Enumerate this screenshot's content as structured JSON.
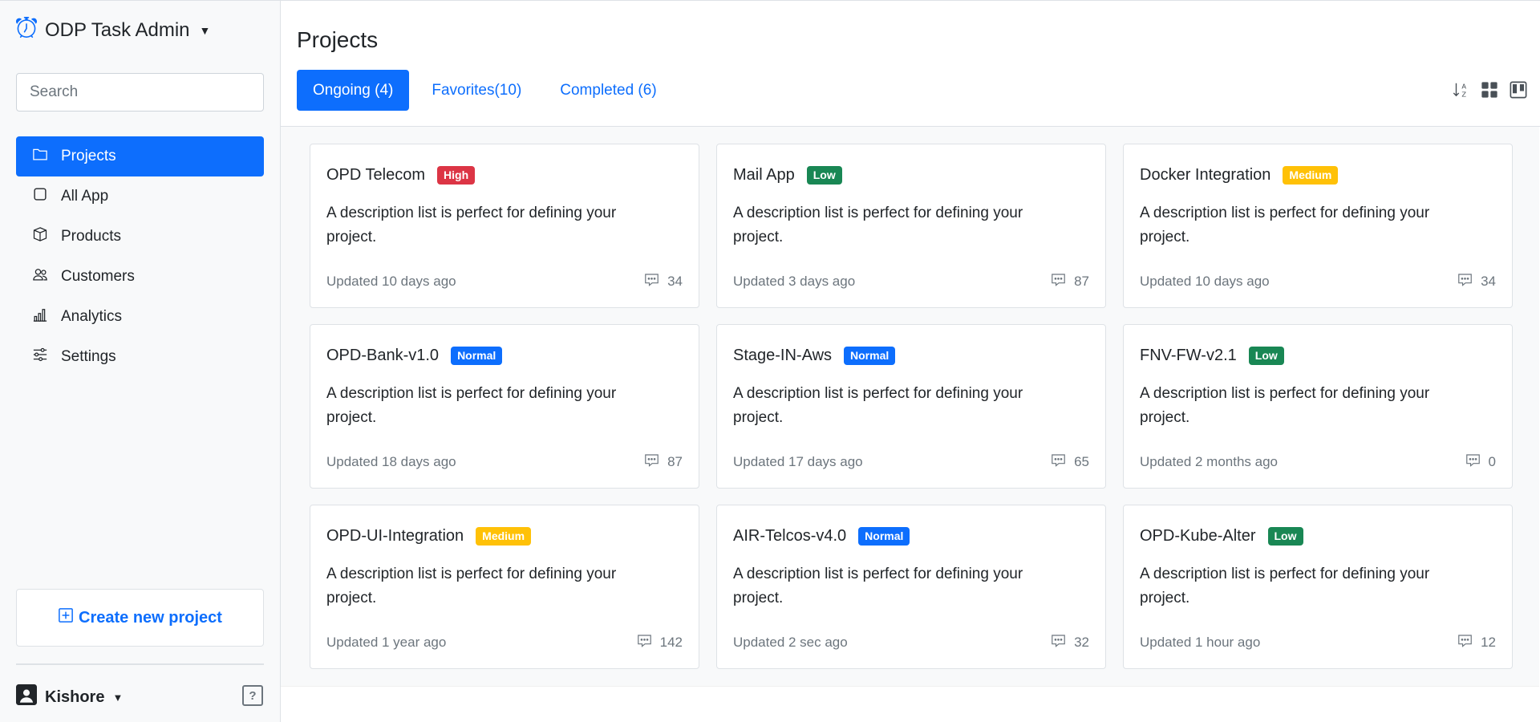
{
  "app": {
    "title": "ODP Task Admin"
  },
  "sidebar": {
    "search_placeholder": "Search",
    "items": [
      {
        "label": "Projects",
        "icon": "folder-icon",
        "active": true
      },
      {
        "label": "All App",
        "icon": "square-icon",
        "active": false
      },
      {
        "label": "Products",
        "icon": "box-icon",
        "active": false
      },
      {
        "label": "Customers",
        "icon": "users-icon",
        "active": false
      },
      {
        "label": "Analytics",
        "icon": "bar-chart-icon",
        "active": false
      },
      {
        "label": "Settings",
        "icon": "sliders-icon",
        "active": false
      }
    ],
    "create_label": "Create new project",
    "user_name": "Kishore",
    "help_label": "?"
  },
  "main": {
    "title": "Projects",
    "tabs": [
      {
        "label": "Ongoing (4)",
        "active": true
      },
      {
        "label": "Favorites(10)",
        "active": false
      },
      {
        "label": "Completed (6)",
        "active": false
      }
    ],
    "view_tools": [
      "sort-alpha-icon",
      "grid-view-icon",
      "kanban-view-icon"
    ]
  },
  "projects": [
    {
      "name": "OPD Telecom",
      "priority": "High",
      "priority_class": "high",
      "description": "A description list is perfect for defining your project.",
      "updated": "Updated 10 days ago",
      "comments": "34"
    },
    {
      "name": "Mail App",
      "priority": "Low",
      "priority_class": "low",
      "description": "A description list is perfect for defining your project.",
      "updated": "Updated 3 days ago",
      "comments": "87"
    },
    {
      "name": "Docker Integration",
      "priority": "Medium",
      "priority_class": "medium",
      "description": "A description list is perfect for defining your project.",
      "updated": "Updated 10 days ago",
      "comments": "34"
    },
    {
      "name": "OPD-Bank-v1.0",
      "priority": "Normal",
      "priority_class": "normal",
      "description": "A description list is perfect for defining your project.",
      "updated": "Updated 18 days ago",
      "comments": "87"
    },
    {
      "name": "Stage-IN-Aws",
      "priority": "Normal",
      "priority_class": "normal",
      "description": "A description list is perfect for defining your project.",
      "updated": "Updated 17 days ago",
      "comments": "65"
    },
    {
      "name": "FNV-FW-v2.1",
      "priority": "Low",
      "priority_class": "low",
      "description": "A description list is perfect for defining your project.",
      "updated": "Updated 2 months ago",
      "comments": "0"
    },
    {
      "name": "OPD-UI-Integration",
      "priority": "Medium",
      "priority_class": "medium",
      "description": "A description list is perfect for defining your project.",
      "updated": "Updated 1 year ago",
      "comments": "142"
    },
    {
      "name": "AIR-Telcos-v4.0",
      "priority": "Normal",
      "priority_class": "normal",
      "description": "A description list is perfect for defining your project.",
      "updated": "Updated 2 sec ago",
      "comments": "32"
    },
    {
      "name": "OPD-Kube-Alter",
      "priority": "Low",
      "priority_class": "low",
      "description": "A description list is perfect for defining your project.",
      "updated": "Updated 1 hour ago",
      "comments": "12"
    }
  ],
  "colors": {
    "primary": "#0d6efd",
    "high": "#dc3545",
    "low": "#198754",
    "medium": "#ffc107",
    "normal": "#0d6efd"
  }
}
